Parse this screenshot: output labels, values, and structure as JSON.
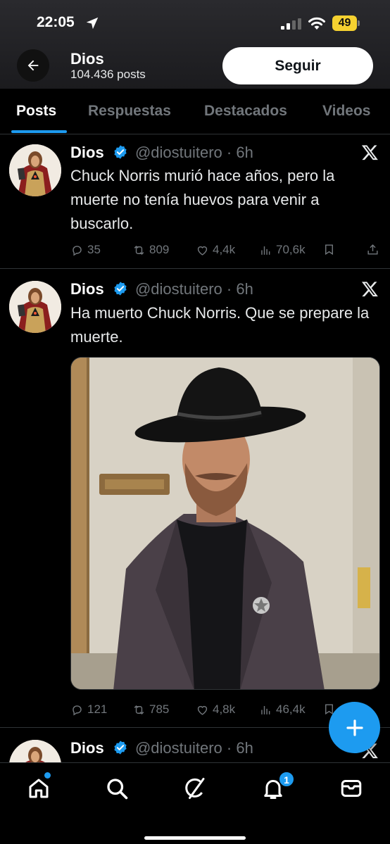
{
  "status_bar": {
    "time": "22:05",
    "battery": "49"
  },
  "header": {
    "name": "Dios",
    "posts_count": "104.436 posts",
    "follow_label": "Seguir"
  },
  "tabs": [
    {
      "label": "Posts",
      "active": true
    },
    {
      "label": "Respuestas"
    },
    {
      "label": "Destacados"
    },
    {
      "label": "Videos"
    }
  ],
  "tweets": [
    {
      "name": "Dios",
      "handle": "@diostuitero",
      "time": "· 6h",
      "text": "Chuck Norris murió hace años, pero la muerte no tenía huevos para venir a buscarlo.",
      "replies": "35",
      "retweets": "809",
      "likes": "4,4k",
      "views": "70,6k"
    },
    {
      "name": "Dios",
      "handle": "@diostuitero",
      "time": "· 6h",
      "text": "Ha muerto Chuck Norris. Que se prepare la muerte.",
      "replies": "121",
      "retweets": "785",
      "likes": "4,8k",
      "views": "46,4k"
    },
    {
      "name": "Dios",
      "handle": "@diostuitero",
      "time": "· 6h"
    }
  ],
  "notifications": {
    "badge": "1"
  },
  "colors": {
    "accent": "#1d9bf0",
    "background": "#000000",
    "muted": "#71767b",
    "battery": "#f5d130"
  },
  "icons": [
    "back-arrow-icon",
    "verified-icon",
    "x-logo-icon",
    "reply-icon",
    "retweet-icon",
    "like-icon",
    "views-icon",
    "bookmark-icon",
    "share-icon",
    "compose-plus-icon",
    "home-icon",
    "search-icon",
    "grok-icon",
    "bell-icon",
    "mail-icon"
  ]
}
